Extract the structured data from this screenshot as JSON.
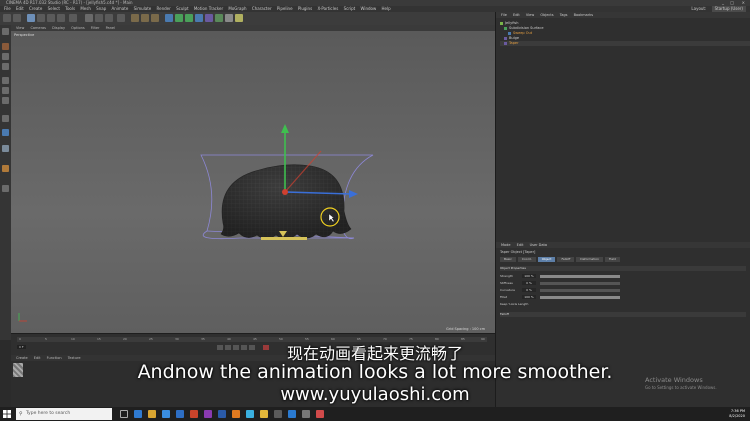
{
  "app": {
    "title": "CINEMA 4D R17.032 Studio (RC - R17) - [jellyfish5.c4d *] - Main",
    "window_controls": [
      "_",
      "□",
      "×"
    ],
    "layout_label": "Layout:",
    "layout_value": "Startup (User)"
  },
  "menubar": [
    "File",
    "Edit",
    "Create",
    "Select",
    "Tools",
    "Mesh",
    "Snap",
    "Animate",
    "Simulate",
    "Render",
    "Sculpt",
    "Motion Tracker",
    "MoGraph",
    "Character",
    "Pipeline",
    "Plugins",
    "X-Particles",
    "Script",
    "Window",
    "Help"
  ],
  "viewport": {
    "menu": [
      "View",
      "Cameras",
      "Display",
      "Options",
      "Filter",
      "Panel"
    ],
    "label": "Perspective",
    "grid_spacing": "Grid Spacing : 100 cm"
  },
  "timeline": {
    "ticks": [
      "0",
      "5",
      "10",
      "15",
      "20",
      "25",
      "30",
      "35",
      "40",
      "45",
      "50",
      "55",
      "60",
      "65",
      "70",
      "75",
      "80",
      "85",
      "90"
    ],
    "current_frame": "0 F"
  },
  "material_manager": {
    "menu": [
      "Create",
      "Edit",
      "Function",
      "Texture"
    ]
  },
  "object_manager": {
    "menu": [
      "File",
      "Edit",
      "View",
      "Objects",
      "Tags",
      "Bookmarks"
    ],
    "objects": [
      "Jellyfish",
      "Subdivision Surface",
      "Sweep Out",
      "Bulge",
      "Taper"
    ]
  },
  "attributes": {
    "menu": [
      "Mode",
      "Edit",
      "User Data"
    ],
    "title": "Taper Object [Taper]",
    "tabs": [
      "Basic",
      "Coord.",
      "Object",
      "Falloff",
      "Deformation",
      "Field"
    ],
    "active_tab": 2,
    "section": "Object Properties",
    "params": [
      {
        "label": "Strength",
        "value": "100 %",
        "fill": 1.0
      },
      {
        "label": "Stiffness",
        "value": "0 %",
        "fill": 0.0
      },
      {
        "label": "Curvature",
        "value": "0 %",
        "fill": 0.0
      },
      {
        "label": "Fillet",
        "value": "100 %",
        "fill": 1.0
      }
    ],
    "fillet_label": "Keep Y-Axis Length",
    "collapsed_section": "Falloff"
  },
  "windows_watermark": {
    "line1": "Activate Windows",
    "line2": "Go to Settings to activate Windows."
  },
  "subtitles": {
    "chinese": "现在动画看起来更流畅了",
    "english": "Andnow the animation looks a lot more smoother.",
    "url": "www.yuyulaoshi.com"
  },
  "taskbar": {
    "search_placeholder": "Type here to search",
    "time": "7:36 PM",
    "date": "8/2/2020"
  },
  "colors": {
    "axis_x": "#3a6fd8",
    "axis_y": "#3fbf4f",
    "axis_z": "#d04030",
    "cage": "#8d88d6",
    "active_tab": "#5d7fa8"
  }
}
